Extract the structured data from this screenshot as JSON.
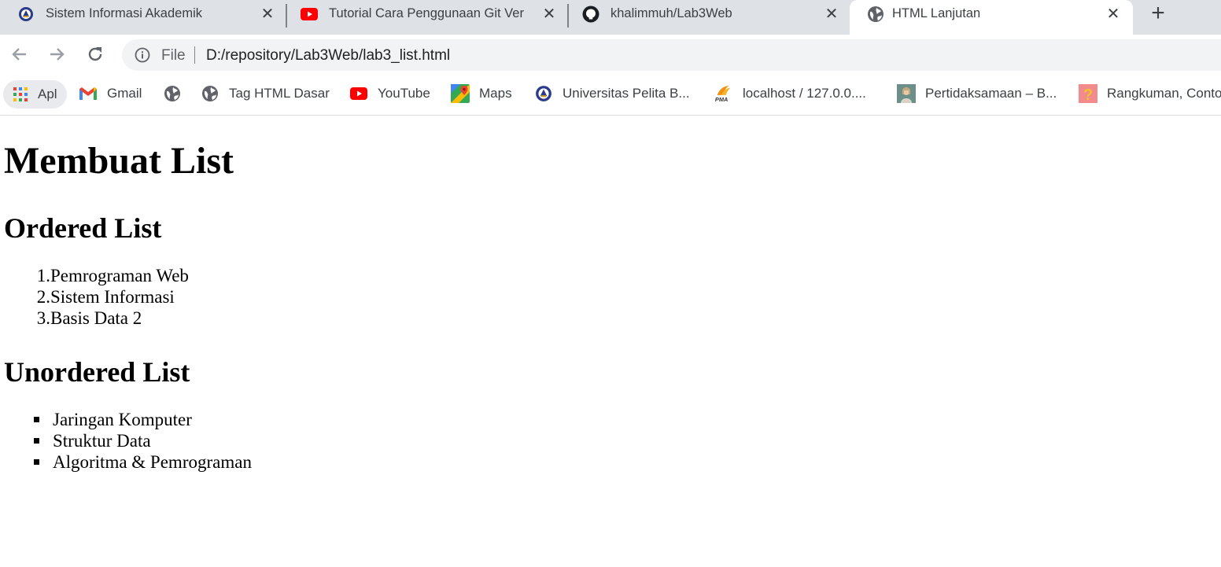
{
  "browser": {
    "tabs": [
      {
        "title": "Sistem Informasi Akademik",
        "icon": "university-seal-icon",
        "active": false
      },
      {
        "title": "Tutorial Cara Penggunaan Git Ver",
        "icon": "youtube-icon",
        "active": false
      },
      {
        "title": "khalimmuh/Lab3Web",
        "icon": "github-icon",
        "active": false
      },
      {
        "title": "HTML Lanjutan",
        "icon": "globe-icon",
        "active": true
      }
    ],
    "close_glyph": "✕",
    "new_tab_glyph": "+",
    "address_bar": {
      "scheme_label": "File",
      "url": "D:/repository/Lab3Web/lab3_list.html"
    },
    "bookmarks": [
      {
        "label": "Apl",
        "icon": "apps-grid-icon"
      },
      {
        "label": "Gmail",
        "icon": "gmail-icon"
      },
      {
        "label": "",
        "icon": "globe-icon"
      },
      {
        "label": "Tag HTML Dasar",
        "icon": "globe-icon"
      },
      {
        "label": "YouTube",
        "icon": "youtube-icon"
      },
      {
        "label": "Maps",
        "icon": "maps-icon"
      },
      {
        "label": "Universitas Pelita B...",
        "icon": "university-seal-icon"
      },
      {
        "label": "localhost / 127.0.0....",
        "icon": "phpmyadmin-icon"
      },
      {
        "label": "Pertidaksamaan – B...",
        "icon": "thumbnail-icon"
      },
      {
        "label": "Rangkuman, Contoh",
        "icon": "question-thumbnail-icon"
      }
    ]
  },
  "page": {
    "heading": "Membuat List",
    "ordered": {
      "heading": "Ordered List",
      "markers": [
        "1.",
        "2.",
        "3."
      ],
      "items": [
        "Pemrograman Web",
        "Sistem Informasi",
        "Basis Data 2"
      ]
    },
    "unordered": {
      "heading": "Unordered List",
      "items": [
        "Jaringan Komputer",
        "Struktur Data",
        "Algoritma & Pemrograman"
      ]
    }
  },
  "colors": {
    "tab_strip": "#dee1e6",
    "omnibox": "#f1f3f4",
    "youtube_red": "#ff0000"
  }
}
